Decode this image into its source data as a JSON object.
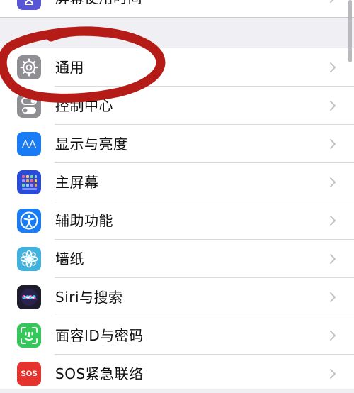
{
  "top_partial": {
    "label": "屏幕使用时间",
    "icon": "hourglass-icon",
    "color": "#5856d6"
  },
  "rows": [
    {
      "label": "通用",
      "icon": "gear-icon",
      "color": "#8e8e93"
    },
    {
      "label": "控制中心",
      "icon": "toggles-icon",
      "color": "#8e8e93"
    },
    {
      "label": "显示与亮度",
      "icon": "text-size-icon",
      "icon_text": "AA",
      "color": "#1a7cf5"
    },
    {
      "label": "主屏幕",
      "icon": "app-grid-icon",
      "color": "#2a4ad8"
    },
    {
      "label": "辅助功能",
      "icon": "accessibility-icon",
      "color": "#1a7cf5"
    },
    {
      "label": "墙纸",
      "icon": "flower-icon",
      "color": "#3fb3dd"
    },
    {
      "label": "Siri与搜索",
      "icon": "siri-icon",
      "color": "#1d1d2b"
    },
    {
      "label": "面容ID与密码",
      "icon": "face-id-icon",
      "color": "#34c759"
    },
    {
      "label": "SOS紧急联络",
      "icon": "sos-icon",
      "icon_text": "SOS",
      "color": "#e3332c"
    }
  ]
}
